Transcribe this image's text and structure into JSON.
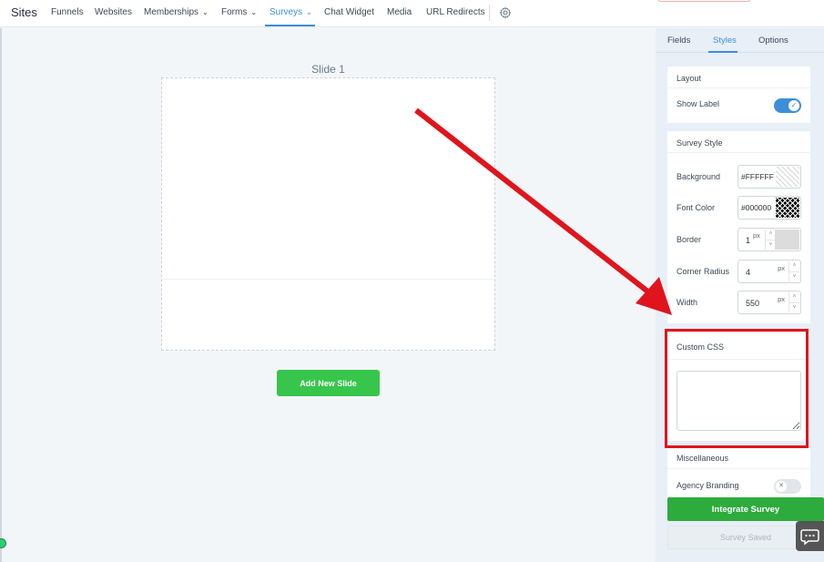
{
  "nav": {
    "brand": "Sites",
    "items": [
      {
        "label": "Funnels"
      },
      {
        "label": "Websites"
      },
      {
        "label": "Memberships"
      },
      {
        "label": "Forms"
      },
      {
        "label": "Surveys"
      },
      {
        "label": "Chat Widget"
      },
      {
        "label": "Media"
      },
      {
        "label": "URL Redirects"
      }
    ],
    "active": "Surveys",
    "settings_icon": "gear-icon"
  },
  "canvas": {
    "slide_title": "Slide 1",
    "add_slide_label": "Add New Slide"
  },
  "panel": {
    "tabs": [
      {
        "label": "Fields"
      },
      {
        "label": "Styles"
      },
      {
        "label": "Options"
      }
    ],
    "active_tab": "Styles",
    "layout": {
      "title": "Layout",
      "show_label": "Show Label",
      "show_label_on": true
    },
    "survey_style": {
      "title": "Survey Style",
      "background_label": "Background",
      "background_value": "#FFFFFF",
      "font_color_label": "Font Color",
      "font_color_value": "#000000",
      "border_label": "Border",
      "border_value": "1",
      "border_unit": "px",
      "corner_radius_label": "Corner Radius",
      "corner_radius_value": "4",
      "corner_radius_unit": "px",
      "width_label": "Width",
      "width_value": "550",
      "width_unit": "px"
    },
    "custom_css": {
      "title": "Custom CSS",
      "value": ""
    },
    "misc": {
      "title": "Miscellaneous",
      "agency_branding": "Agency Branding",
      "agency_branding_on": false
    },
    "integrate_label": "Integrate Survey",
    "saved_label": "Survey Saved"
  },
  "colors": {
    "accent": "#3c8ed9",
    "primary_green": "#37c64b",
    "integrate_green": "#2eab3d",
    "annotation_red": "#e0141c"
  }
}
